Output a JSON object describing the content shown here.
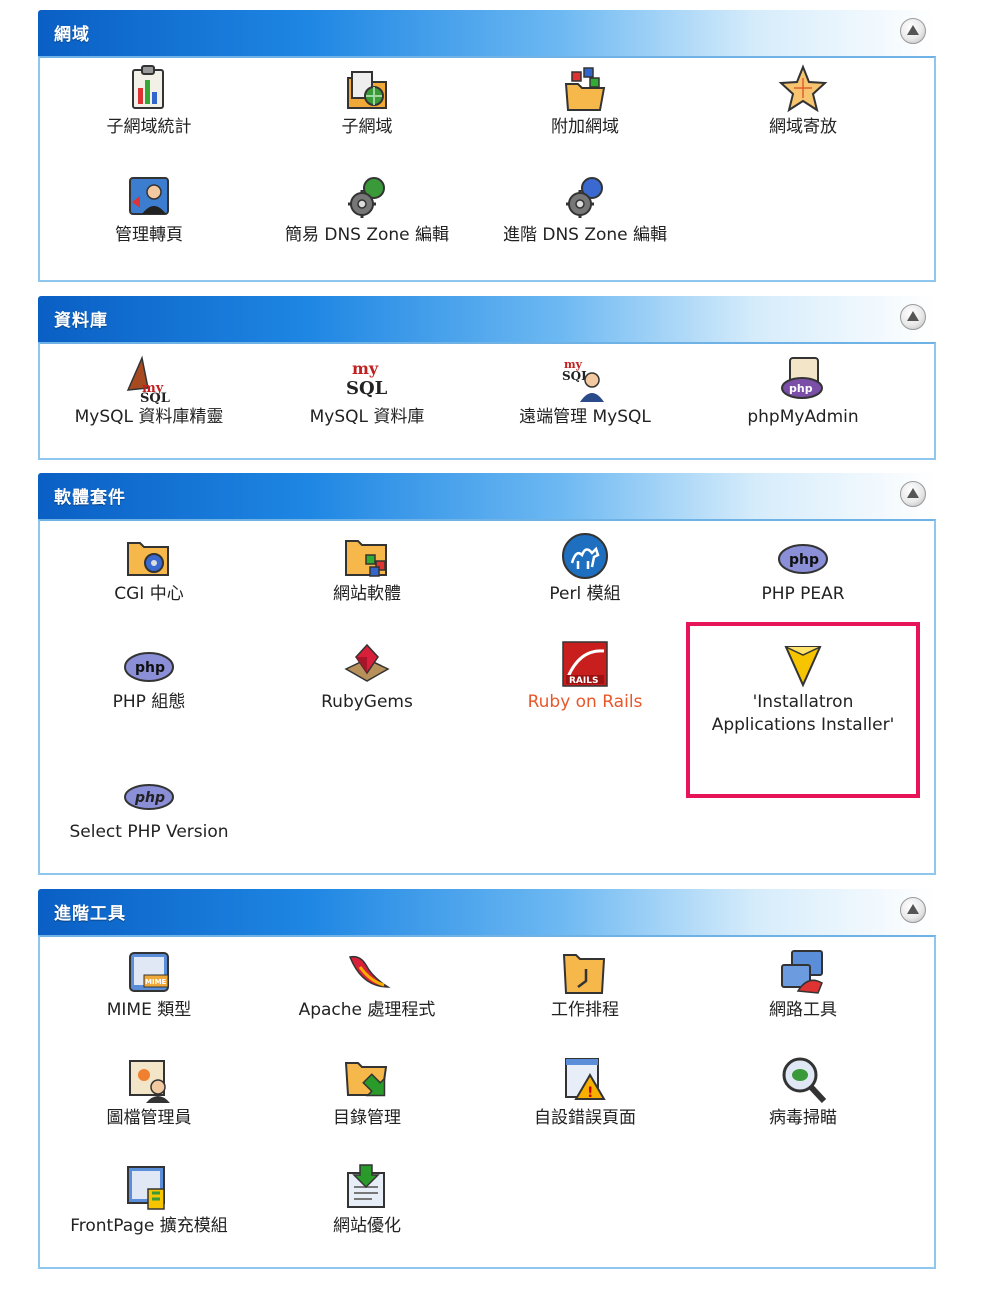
{
  "colors": {
    "header_start": "#0a5fc4",
    "panel_border": "#8fc6ee",
    "highlight": "#e8145a",
    "rails_red": "#e8572a"
  },
  "sections": {
    "domains": {
      "title": "網域",
      "items": [
        "子網域統計",
        "子網域",
        "附加網域",
        "網域寄放",
        "管理轉頁",
        "簡易 DNS Zone 編輯",
        "進階 DNS Zone 編輯"
      ]
    },
    "database": {
      "title": "資料庫",
      "items": [
        "MySQL 資料庫精靈",
        "MySQL 資料庫",
        "遠端管理 MySQL",
        "phpMyAdmin"
      ]
    },
    "software": {
      "title": "軟體套件",
      "items": [
        "CGI 中心",
        "網站軟體",
        "Perl 模組",
        "PHP PEAR",
        "PHP 組態",
        "RubyGems",
        "Ruby on Rails",
        "'Installatron",
        "Applications Installer'",
        "Select PHP Version"
      ]
    },
    "advanced": {
      "title": "進階工具",
      "items": [
        "MIME 類型",
        "Apache 處理程式",
        "工作排程",
        "網路工具",
        "圖檔管理員",
        "目錄管理",
        "自設錯誤頁面",
        "病毒掃瞄",
        "FrontPage 擴充模組",
        "網站優化"
      ]
    }
  },
  "icons": {
    "subdomain_stats": "chart-folder-icon",
    "subdomains": "folder-globe-icon",
    "addon_domains": "folder-cubes-icon",
    "parked_domains": "star-icon",
    "redirects": "redirect-person-icon",
    "dns_simple": "gear-globe-icon",
    "dns_advanced": "gear-globe-icon",
    "mysql_wizard": "mysql-wizard-icon",
    "mysql": "mysql-icon",
    "remote_mysql": "remote-mysql-icon",
    "phpmyadmin": "phpmyadmin-icon",
    "cgi": "folder-gear-icon",
    "site_software": "folder-cubes-icon",
    "perl": "camel-icon",
    "php_pear": "php-icon",
    "php_config": "php-icon",
    "rubygems": "ruby-gem-icon",
    "rails": "rails-icon",
    "installatron": "installatron-icon",
    "select_php": "php-icon",
    "mime": "mime-icon",
    "apache": "apache-feather-icon",
    "cron": "folder-clock-icon",
    "network": "network-tools-icon",
    "image_manager": "image-manager-icon",
    "directory": "folder-arrow-icon",
    "error_pages": "warning-window-icon",
    "virus": "virus-scan-icon",
    "frontpage": "frontpage-icon",
    "optimize": "optimize-icon"
  }
}
